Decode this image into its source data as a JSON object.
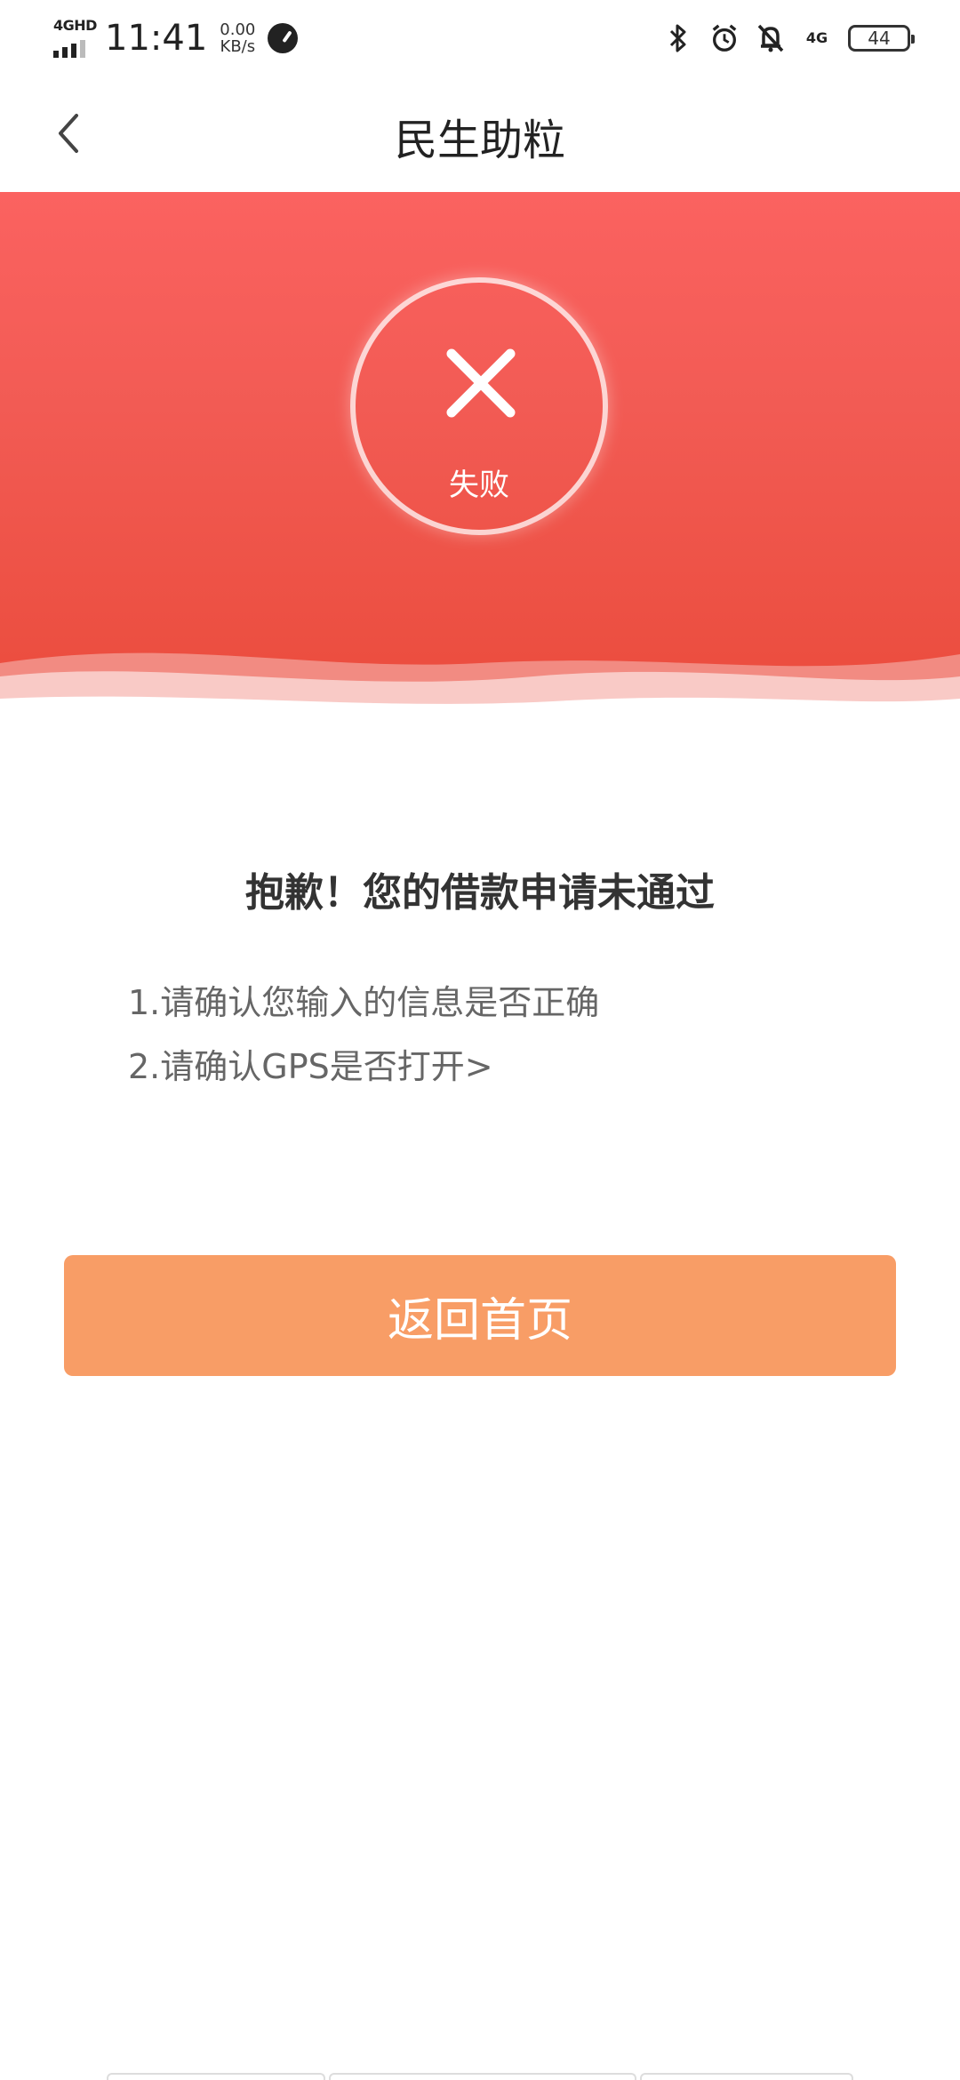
{
  "status_bar": {
    "network_label": "4GHD",
    "time": "11:41",
    "speed_value": "0.00",
    "speed_unit": "KB/s",
    "right_network": "4G",
    "battery": "44"
  },
  "nav": {
    "title": "民生助粒"
  },
  "result": {
    "status": "失败",
    "title": "抱歉！您的借款申请未通过",
    "tips": [
      "1.请确认您输入的信息是否正确",
      "2.请确认GPS是否打开>"
    ]
  },
  "actions": {
    "home_label": "返回首页"
  },
  "colors": {
    "hero_red": "#f25b54",
    "button_orange": "#f89d66"
  }
}
